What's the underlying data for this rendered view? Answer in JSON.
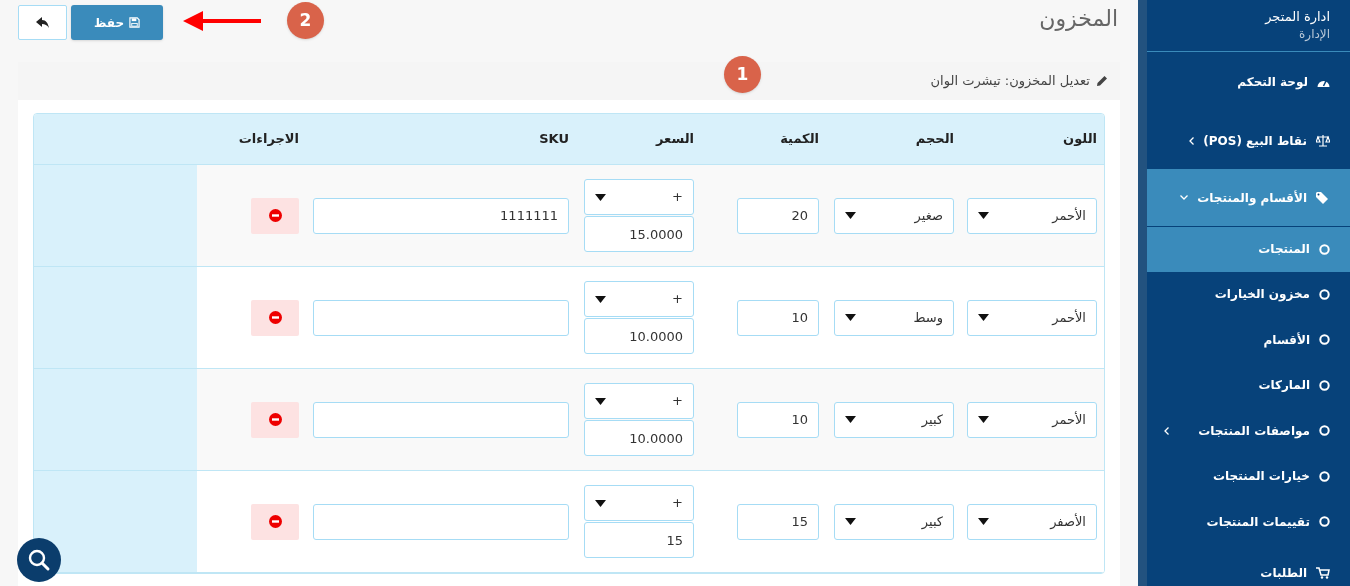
{
  "page_title": "المخزون",
  "toolbar": {
    "save_button": "حفظ"
  },
  "annotations": [
    {
      "label": "2"
    },
    {
      "label": "1"
    }
  ],
  "panel": {
    "heading": "تعديل المخزون: تيشرت الوان"
  },
  "table": {
    "columns": [
      "اللون",
      "الحجم",
      "الكمية",
      "السعر",
      "SKU",
      "الاجراءات"
    ],
    "rows": [
      {
        "color_name": "الأحمر",
        "size": "صغير",
        "quantity": "20",
        "price_sign": "+",
        "price": "15.0000",
        "sku": "1111111"
      },
      {
        "color_name": "الأحمر",
        "size": "وسط",
        "quantity": "10",
        "price_sign": "+",
        "price": "10.0000"
      },
      {
        "color_name": "الأحمر",
        "size": "كبير",
        "quantity": "10",
        "price_sign": "+",
        "price": "10.0000"
      },
      {
        "color_name": "الأصفر",
        "size": "كبير",
        "quantity": "15",
        "price_sign": "+",
        "price": "15"
      }
    ]
  },
  "sidebar": {
    "title": "ادارة المتجر",
    "subtitle": "الإدارة",
    "items": [
      {
        "label": "لوحة التحكم",
        "kind": "page",
        "selected": false
      },
      {
        "label": "نقاط البيع (POS)",
        "kind": "folder",
        "expanded": false,
        "selected": false
      },
      {
        "label": "الأقسام والمنتجات",
        "kind": "folder",
        "expanded": true,
        "selected": true,
        "children": [
          {
            "label": "المنتجات",
            "kind": "page",
            "selected": true
          },
          {
            "label": "مخزون الخيارات",
            "kind": "page",
            "selected": false
          },
          {
            "label": "الأقسام",
            "kind": "page",
            "selected": false
          },
          {
            "label": "الماركات",
            "kind": "page",
            "selected": false
          },
          {
            "label": "مواصفات المنتجات",
            "kind": "folder",
            "expanded": false,
            "selected": false
          },
          {
            "label": "خيارات المنتجات",
            "kind": "page",
            "selected": false
          },
          {
            "label": "تقييمات المنتجات",
            "kind": "page",
            "selected": false
          }
        ]
      },
      {
        "label": "الطلبات",
        "kind": "page",
        "selected": false
      }
    ]
  }
}
